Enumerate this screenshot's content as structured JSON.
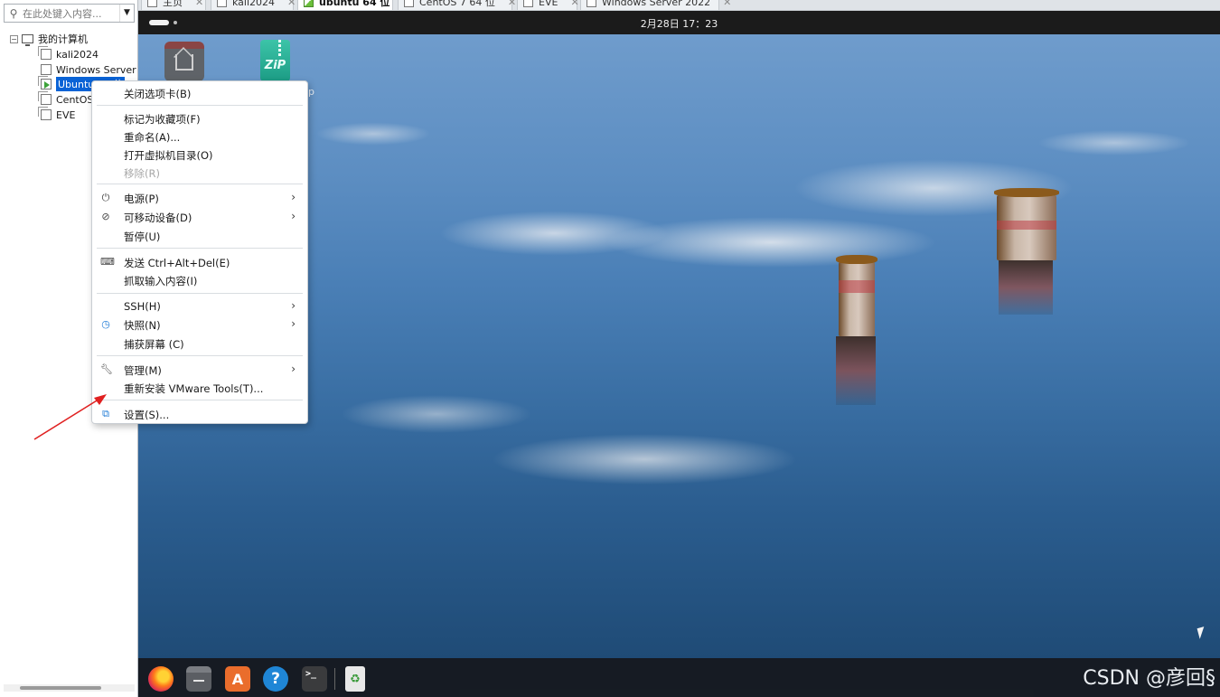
{
  "tabs": [
    {
      "label": "主页",
      "active": false
    },
    {
      "label": "kali2024",
      "active": false
    },
    {
      "label": "ubuntu 64 位",
      "active": true
    },
    {
      "label": "CentOS 7 64 位",
      "active": false
    },
    {
      "label": "EVE",
      "active": false
    },
    {
      "label": "Windows Server 2022",
      "active": false
    }
  ],
  "sidebar": {
    "search_placeholder": "在此处键入内容...",
    "root_label": "我的计算机",
    "items": [
      {
        "label": "kali2024"
      },
      {
        "label": "Windows Server"
      },
      {
        "label": "Ubuntu 64 位"
      },
      {
        "label": "CentOS"
      },
      {
        "label": "EVE"
      }
    ]
  },
  "guest": {
    "clock": "2月28日  17：23",
    "desktop_label_partial": "p"
  },
  "context_menu": {
    "items": [
      {
        "label": "关闭选项卡(B)",
        "icon": ""
      },
      {
        "label": "标记为收藏项(F)",
        "icon": ""
      },
      {
        "label": "重命名(A)...",
        "icon": ""
      },
      {
        "label": "打开虚拟机目录(O)",
        "icon": ""
      },
      {
        "label": "移除(R)",
        "icon": "",
        "disabled": true
      },
      {
        "label": "电源(P)",
        "icon": "power-icon",
        "submenu": true
      },
      {
        "label": "可移动设备(D)",
        "icon": "removable-device-icon",
        "submenu": true
      },
      {
        "label": "暂停(U)",
        "icon": ""
      },
      {
        "label": "发送 Ctrl+Alt+Del(E)",
        "icon": "send-keys-icon"
      },
      {
        "label": "抓取输入内容(I)",
        "icon": ""
      },
      {
        "label": "SSH(H)",
        "icon": "",
        "submenu": true
      },
      {
        "label": "快照(N)",
        "icon": "snapshot-icon",
        "submenu": true
      },
      {
        "label": "捕获屏幕 (C)",
        "icon": ""
      },
      {
        "label": "管理(M)",
        "icon": "wrench-icon",
        "submenu": true
      },
      {
        "label": "重新安装 VMware Tools(T)...",
        "icon": ""
      },
      {
        "label": "设置(S)...",
        "icon": "settings-icon"
      }
    ]
  },
  "watermark": "CSDN @彦回§",
  "colors": {
    "selection": "#0a63d6",
    "annotation_arrow": "#e02020",
    "guest_topbar": "#1b1b1b"
  }
}
